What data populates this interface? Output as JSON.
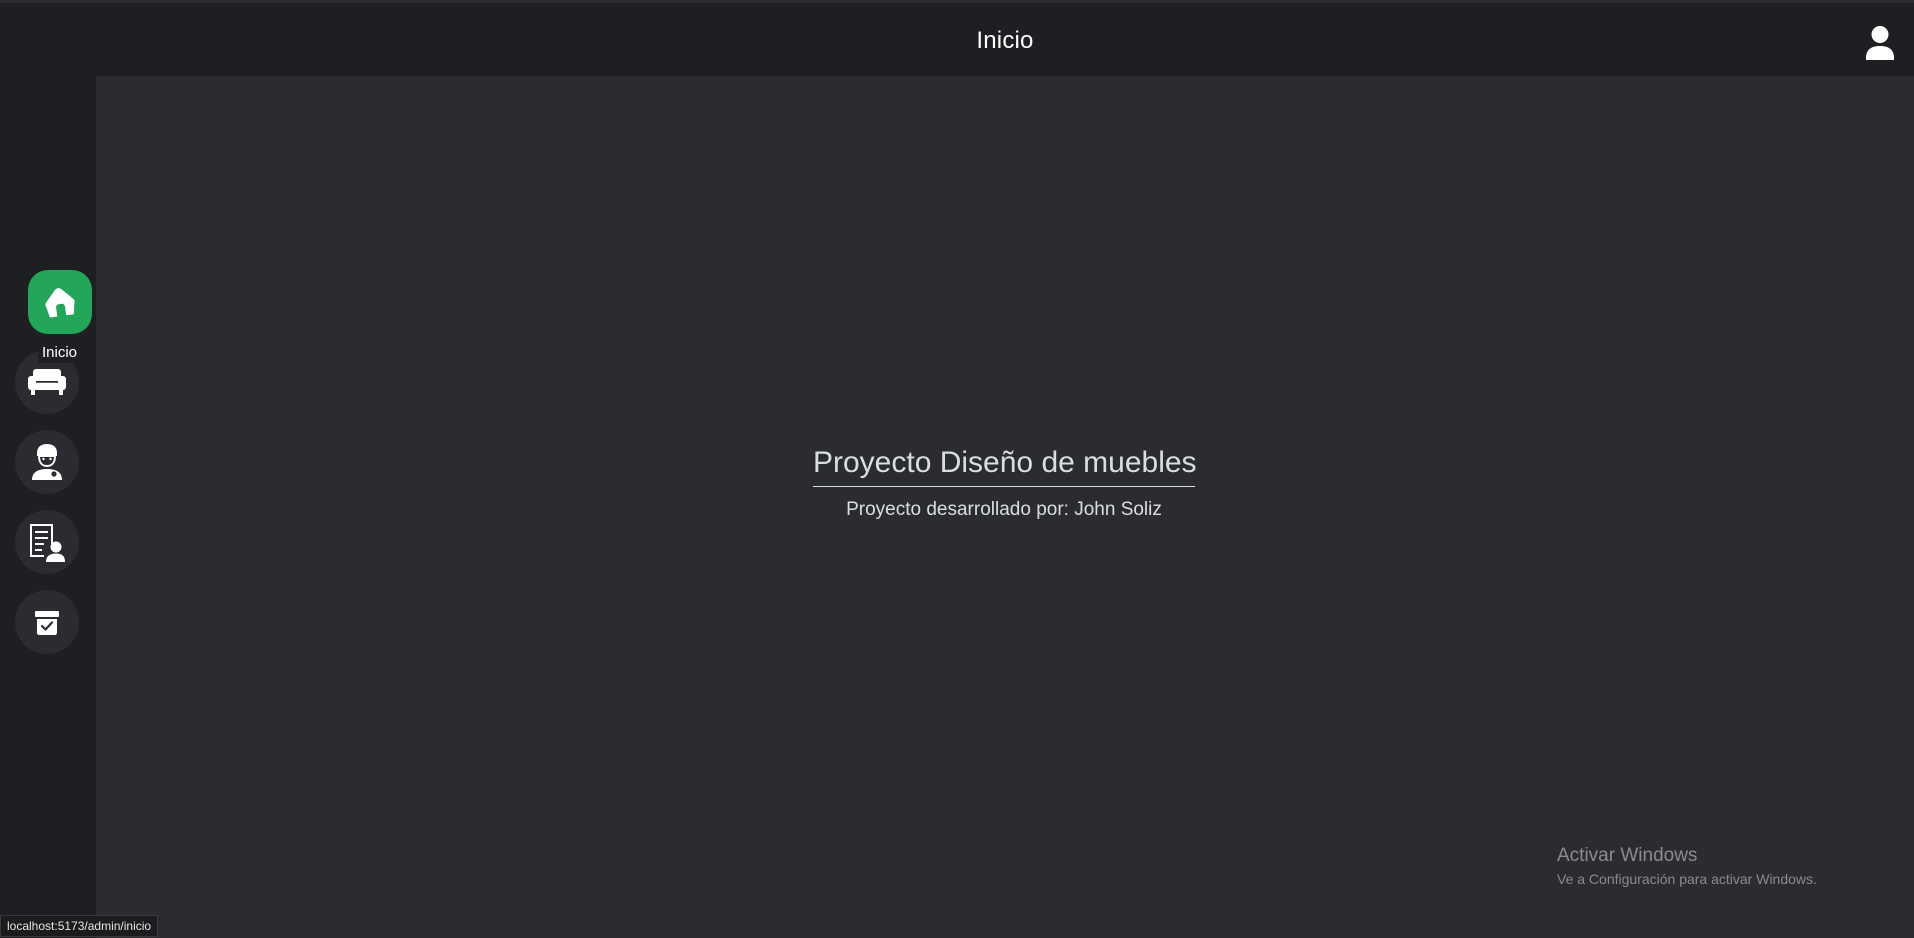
{
  "header": {
    "title": "Inicio",
    "user_icon": "user-icon"
  },
  "sidebar": {
    "items": [
      {
        "icon": "home-icon",
        "label": "Inicio",
        "active": true
      },
      {
        "icon": "sofa-icon",
        "active": false
      },
      {
        "icon": "worker-icon",
        "active": false
      },
      {
        "icon": "client-list-icon",
        "active": false
      },
      {
        "icon": "archive-check-icon",
        "active": false
      }
    ],
    "tooltip": "Inicio",
    "accent_color": "#23a55a"
  },
  "main": {
    "title": "Proyecto Diseño de muebles",
    "subtitle": "Proyecto desarrollado por: John Soliz"
  },
  "watermark": {
    "title": "Activar Windows",
    "subtitle": "Ve a Configuración para activar Windows."
  },
  "statusbar": {
    "url": "localhost:5173/admin/inicio"
  }
}
